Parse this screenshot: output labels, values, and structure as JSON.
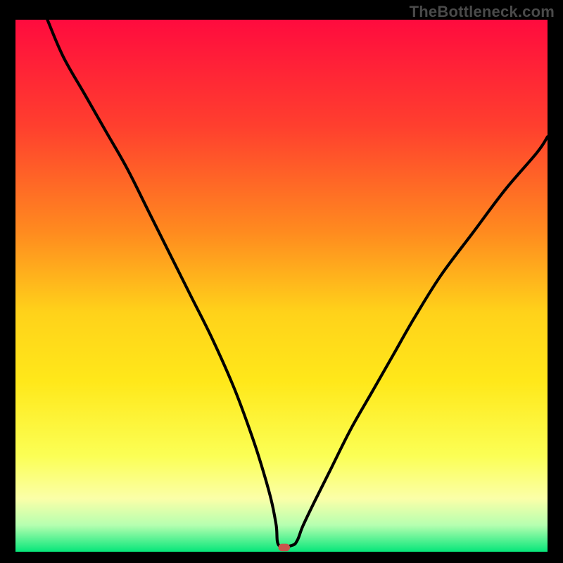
{
  "watermark": "TheBottleneck.com",
  "chart_data": {
    "type": "line",
    "title": "",
    "xlabel": "",
    "ylabel": "",
    "xlim": [
      0,
      100
    ],
    "ylim": [
      0,
      100
    ],
    "grid": false,
    "background_gradient": {
      "stops": [
        {
          "offset": 0.0,
          "color": "#ff0b3e"
        },
        {
          "offset": 0.2,
          "color": "#ff3f2e"
        },
        {
          "offset": 0.4,
          "color": "#ff8b1f"
        },
        {
          "offset": 0.55,
          "color": "#ffd21a"
        },
        {
          "offset": 0.68,
          "color": "#ffe81a"
        },
        {
          "offset": 0.82,
          "color": "#fbff55"
        },
        {
          "offset": 0.9,
          "color": "#fbffa8"
        },
        {
          "offset": 0.95,
          "color": "#b6ffb0"
        },
        {
          "offset": 1.0,
          "color": "#07e67a"
        }
      ]
    },
    "marker": {
      "x": 50.5,
      "y": 0.8,
      "color": "#c9544d"
    },
    "series": [
      {
        "name": "curve",
        "color": "#000000",
        "x": [
          6,
          9,
          13,
          17,
          21,
          25,
          29,
          33,
          37,
          41,
          44,
          46,
          48,
          49,
          49.5,
          52,
          53,
          54,
          56,
          59,
          63,
          67,
          71,
          75,
          80,
          86,
          92,
          98,
          100
        ],
        "values": [
          100,
          93,
          86,
          79,
          72,
          64,
          56,
          48,
          40,
          31,
          23,
          17,
          10,
          5,
          1.2,
          1.2,
          2.2,
          4.8,
          9,
          15,
          23,
          30,
          37,
          44,
          52,
          60,
          68,
          75,
          78
        ]
      }
    ]
  }
}
